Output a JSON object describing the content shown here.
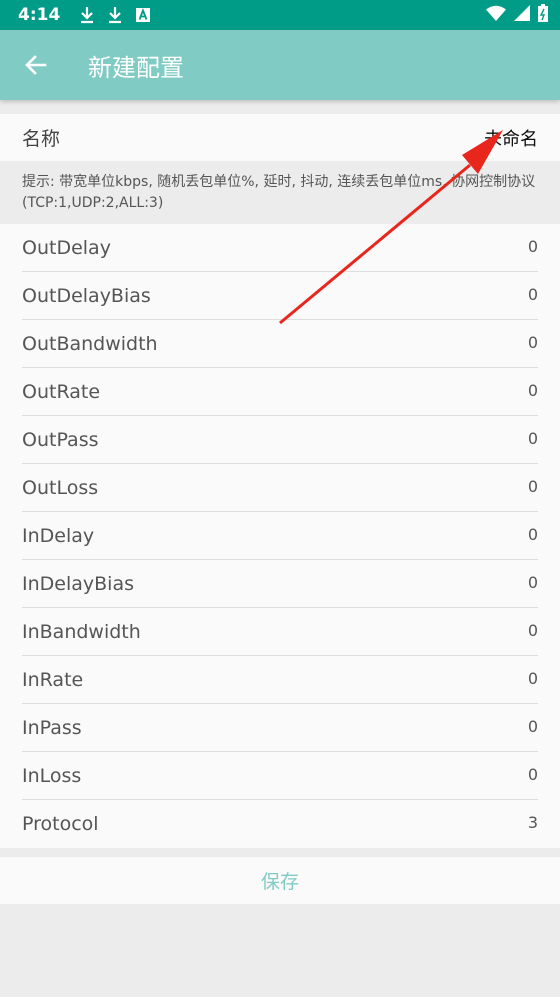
{
  "status_bar": {
    "time": "4:14",
    "icons": [
      "download-icon",
      "download-icon",
      "text-icon",
      "wifi-icon",
      "signal-icon",
      "battery-icon"
    ]
  },
  "app_bar": {
    "title": "新建配置",
    "back_icon": "arrow-left-icon"
  },
  "name_field": {
    "label": "名称",
    "value": "未命名"
  },
  "hint": "提示: 带宽单位kbps, 随机丢包单位%, 延时, 抖动, 连续丢包单位ms, 协网控制协议(TCP:1,UDP:2,ALL:3)",
  "params": [
    {
      "key": "OutDelay",
      "value": "0"
    },
    {
      "key": "OutDelayBias",
      "value": "0"
    },
    {
      "key": "OutBandwidth",
      "value": "0"
    },
    {
      "key": "OutRate",
      "value": "0"
    },
    {
      "key": "OutPass",
      "value": "0"
    },
    {
      "key": "OutLoss",
      "value": "0"
    },
    {
      "key": "InDelay",
      "value": "0"
    },
    {
      "key": "InDelayBias",
      "value": "0"
    },
    {
      "key": "InBandwidth",
      "value": "0"
    },
    {
      "key": "InRate",
      "value": "0"
    },
    {
      "key": "InPass",
      "value": "0"
    },
    {
      "key": "InLoss",
      "value": "0"
    },
    {
      "key": "Protocol",
      "value": "3"
    }
  ],
  "save_label": "保存",
  "colors": {
    "status_bar": "#009c87",
    "app_bar": "#80cbc4",
    "accent": "#80cbc4",
    "annotation_arrow": "#e8261c"
  }
}
